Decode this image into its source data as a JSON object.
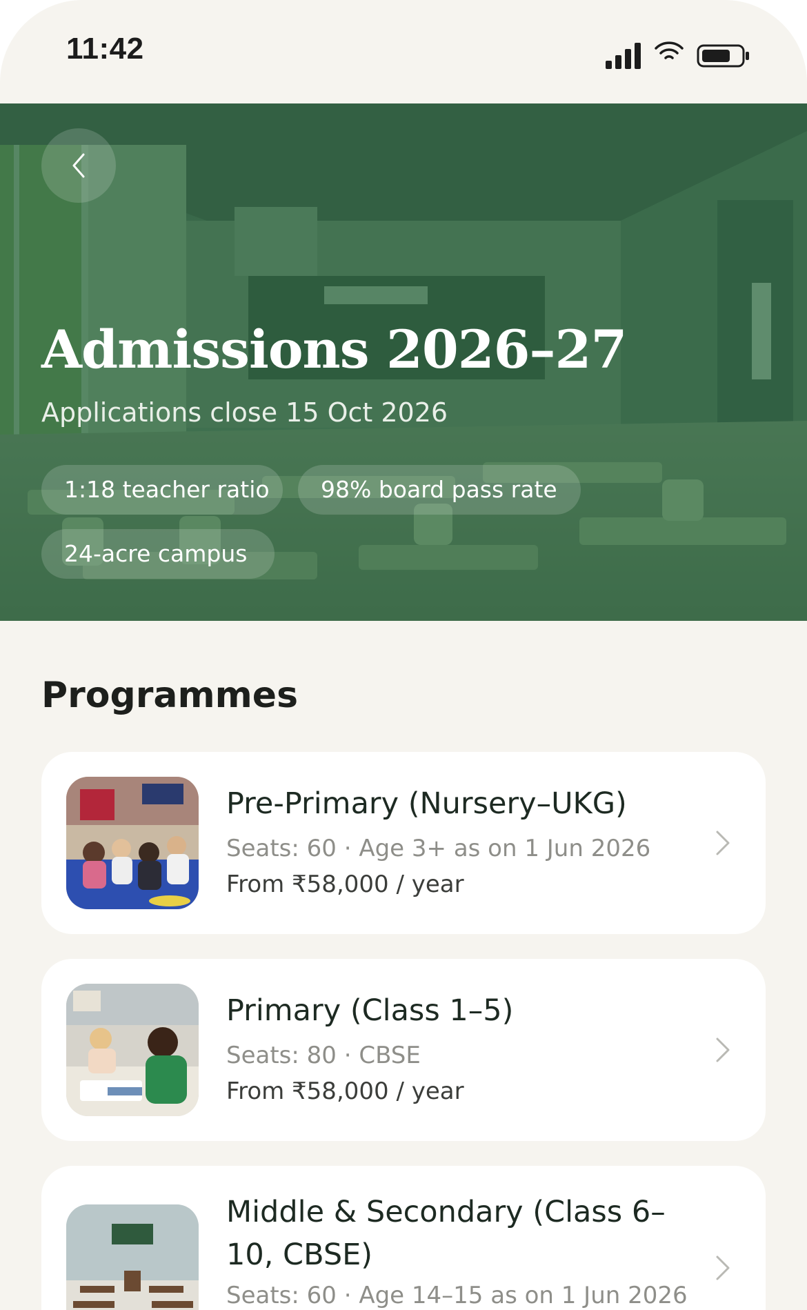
{
  "status_bar": {
    "time": "11:42",
    "icons": [
      "signal-icon",
      "wifi-icon",
      "battery-icon"
    ]
  },
  "hero": {
    "title": "Admissions 2026–27",
    "subtitle": "Applications close 15 Oct 2026",
    "chips": [
      "1:18 teacher ratio",
      "98% board pass rate",
      "24-acre campus"
    ],
    "back_icon": "chevron-left-icon",
    "overlay_color": "#2e6b45"
  },
  "programmes": {
    "title": "Programmes",
    "items": [
      {
        "title": "Pre-Primary (Nursery–UKG)",
        "meta": "Seats: 60 · Age 3+ as on 1 Jun 2026",
        "price": "From ₹58,000 / year"
      },
      {
        "title": "Primary (Class 1–5)",
        "meta": "Seats: 80 · CBSE",
        "price": "From ₹58,000 / year"
      },
      {
        "title": "Middle & Secondary (Class 6–10, CBSE)",
        "meta": "Seats: 60 · Age 14–15 as on 1 Jun 2026"
      }
    ]
  },
  "colors": {
    "background": "#f6f4ef",
    "card": "#ffffff",
    "accent_green": "#2e6b45",
    "text_dark": "#1d2a22",
    "text_muted": "#8e8e89"
  }
}
